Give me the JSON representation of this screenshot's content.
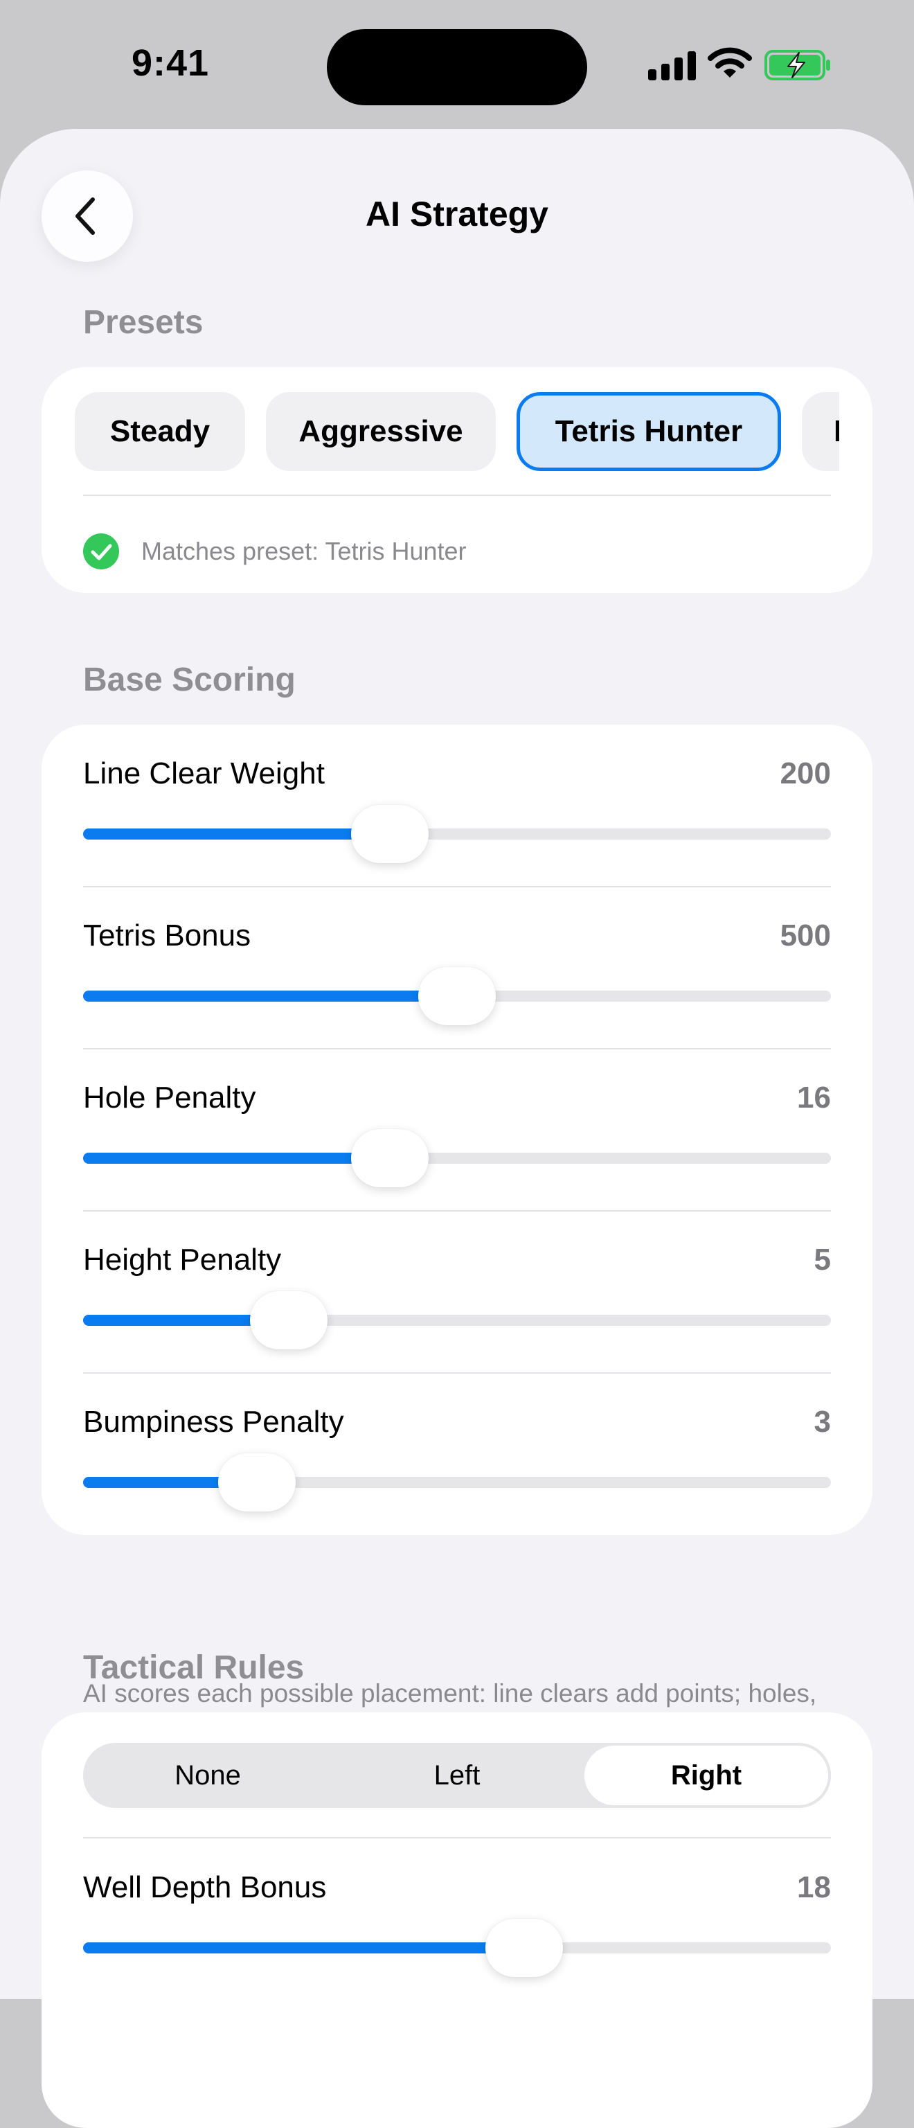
{
  "status_bar": {
    "time": "9:41"
  },
  "nav": {
    "title": "AI Strategy"
  },
  "presets": {
    "header": "Presets",
    "chips": [
      "Steady",
      "Aggressive",
      "Tetris Hunter",
      "B"
    ],
    "selected": "Tetris Hunter",
    "match_text": "Matches preset: Tetris Hunter"
  },
  "base_scoring": {
    "header": "Base Scoring",
    "sliders": [
      {
        "label": "Line Clear Weight",
        "value": "200",
        "fraction": 0.41
      },
      {
        "label": "Tetris Bonus",
        "value": "500",
        "fraction": 0.5
      },
      {
        "label": "Hole Penalty",
        "value": "16",
        "fraction": 0.41
      },
      {
        "label": "Height Penalty",
        "value": "5",
        "fraction": 0.275
      },
      {
        "label": "Bumpiness Penalty",
        "value": "3",
        "fraction": 0.232
      }
    ],
    "footnote": "AI scores each possible placement: line clears add points; holes, height, and bumpiness subtract."
  },
  "tactical": {
    "header": "Tactical Rules",
    "segments": [
      "None",
      "Left",
      "Right"
    ],
    "selected_segment": "Right",
    "sliders": [
      {
        "label": "Well Depth Bonus",
        "value": "18",
        "fraction": 0.59
      }
    ]
  },
  "colors": {
    "accent": "#0a7cf0",
    "selected_chip_bg": "#d4e8fc",
    "success_green": "#34c759",
    "secondary_text": "#8e8e93",
    "background": "#f2f2f7"
  }
}
